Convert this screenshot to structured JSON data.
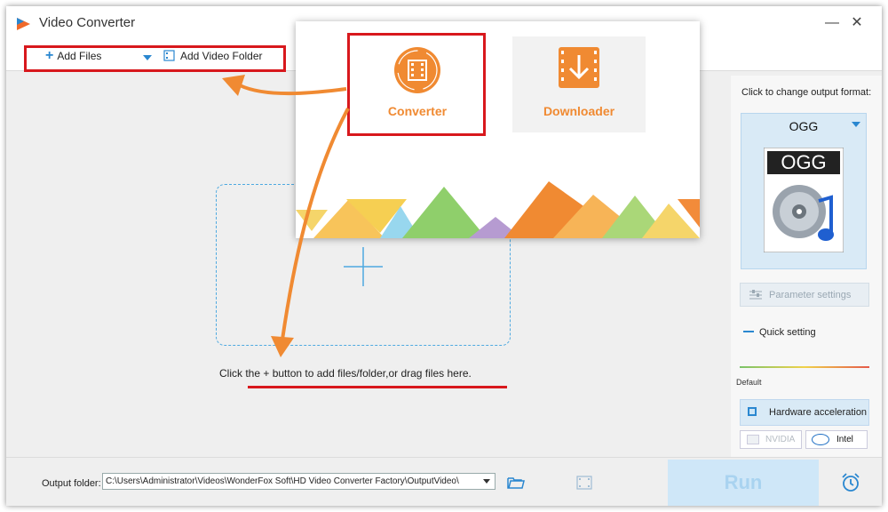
{
  "app": {
    "title": "Video Converter",
    "minimize_glyph": "—",
    "close_glyph": "✕"
  },
  "toolbar": {
    "add_files_label": "Add Files",
    "add_folder_label": "Add Video Folder"
  },
  "launcher": {
    "converter_label": "Converter",
    "downloader_label": "Downloader"
  },
  "main": {
    "drop_hint": "Click the + button to add files/folder,or drag files here."
  },
  "right_panel": {
    "change_format_label": "Click to change output format:",
    "format_name": "OGG",
    "format_icon_text": "OGG",
    "parameter_settings_label": "Parameter settings",
    "quick_setting_label": "Quick setting",
    "slider_default_label": "Default",
    "hardware_acceleration_label": "Hardware acceleration",
    "nvidia_label": "NVIDIA",
    "intel_label": "Intel"
  },
  "bottom": {
    "output_folder_label": "Output folder:",
    "output_path": "C:\\Users\\Administrator\\Videos\\WonderFox Soft\\HD Video Converter Factory\\OutputVideo\\",
    "run_label": "Run"
  },
  "colors": {
    "accent_orange": "#f08a32",
    "highlight_red": "#d8181d",
    "accent_blue": "#2a87d0"
  }
}
